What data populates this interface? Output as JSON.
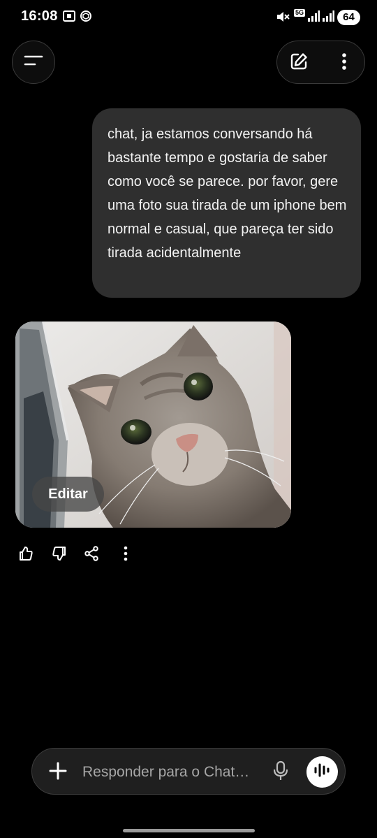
{
  "status_bar": {
    "time": "16:08",
    "network": "5G",
    "battery": "64",
    "icons": [
      "screenshot-icon",
      "chatgpt-icon",
      "mute-icon",
      "signal-icon",
      "signal-icon",
      "battery-icon"
    ]
  },
  "header": {
    "menu_icon": "menu-icon",
    "new_chat_icon": "edit-icon",
    "more_icon": "more-vertical-icon"
  },
  "messages": {
    "user_text": "chat, ja estamos conversando há bastante tempo e gostaria de saber como você se parece. por favor, gere uma foto sua tirada de um iphone bem normal e casual, que pareça ter sido tirada acidentalmente",
    "image_edit_label": "Editar"
  },
  "feedback": [
    "thumbs-up-icon",
    "thumbs-down-icon",
    "share-icon",
    "more-vertical-icon"
  ],
  "composer": {
    "placeholder": "Responder para o Chat…",
    "icons": [
      "plus-icon",
      "mic-icon",
      "voice-wave-icon"
    ]
  },
  "colors": {
    "background": "#000000",
    "bubble": "#2f2f2f",
    "composer": "#1f1f1f",
    "accent": "#ffffff"
  }
}
